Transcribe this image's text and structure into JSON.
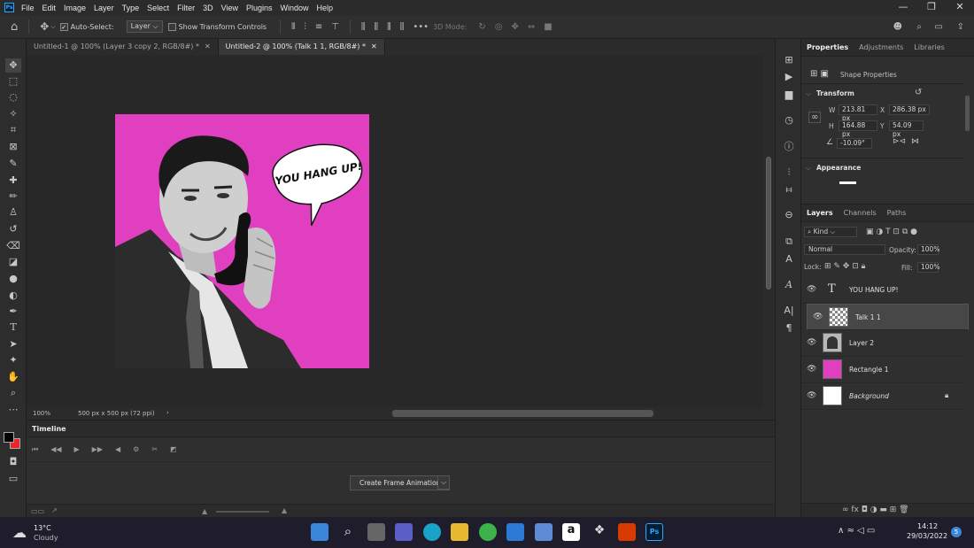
{
  "app": {
    "logo": "Ps",
    "menu": [
      "File",
      "Edit",
      "Image",
      "Layer",
      "Type",
      "Select",
      "Filter",
      "3D",
      "View",
      "Plugins",
      "Window",
      "Help"
    ]
  },
  "window_controls": {
    "minimize": "—",
    "restore": "❐",
    "close": "✕"
  },
  "options_bar": {
    "auto_select_label": "Auto-Select:",
    "auto_select_value": "Layer",
    "show_transform_label": "Show Transform Controls",
    "mode_3d_label": "3D Mode:",
    "more": "•••"
  },
  "tabs": [
    {
      "label": "Untitled-1 @ 100% (Layer 3 copy 2, RGB/8#) *",
      "close": "✕"
    },
    {
      "label": "Untitled-2 @ 100% (Talk 1 1, RGB/8#) *",
      "close": "✕"
    }
  ],
  "canvas": {
    "speech_text": "YOU HANG UP!",
    "artboard_color": "#e040c0"
  },
  "status": {
    "zoom": "100%",
    "doc_size": "500 px x 500 px (72 ppi)"
  },
  "timeline": {
    "title": "Timeline",
    "create_button": "Create Frame Animation"
  },
  "properties": {
    "tabs": [
      "Properties",
      "Adjustments",
      "Libraries"
    ],
    "shape_props": "Shape Properties",
    "transform_title": "Transform",
    "w_label": "W",
    "w": "213.81 px",
    "x_label": "X",
    "x": "286.38 px",
    "h_label": "H",
    "h": "164.88 px",
    "y_label": "Y",
    "y": "54.09 px",
    "angle": "-10.09°",
    "appearance_title": "Appearance"
  },
  "layers": {
    "tabs": [
      "Layers",
      "Channels",
      "Paths"
    ],
    "kind": "Kind",
    "blend": "Normal",
    "opacity_label": "Opacity:",
    "opacity": "100%",
    "lock_label": "Lock:",
    "fill_label": "Fill:",
    "fill": "100%",
    "items": [
      {
        "name": "YOU HANG UP!",
        "type": "text"
      },
      {
        "name": "Talk 1 1",
        "type": "shape"
      },
      {
        "name": "Layer 2",
        "type": "image"
      },
      {
        "name": "Rectangle 1",
        "type": "shape"
      },
      {
        "name": "Background",
        "type": "bg"
      }
    ]
  },
  "taskbar": {
    "weather_temp": "13°C",
    "weather_desc": "Cloudy",
    "time": "14:12",
    "date": "29/03/2022",
    "notif": "5"
  },
  "colors": {
    "accent": "#31a8ff",
    "magenta": "#e040c0",
    "fg": "#000000",
    "bg": "#e8252b"
  }
}
